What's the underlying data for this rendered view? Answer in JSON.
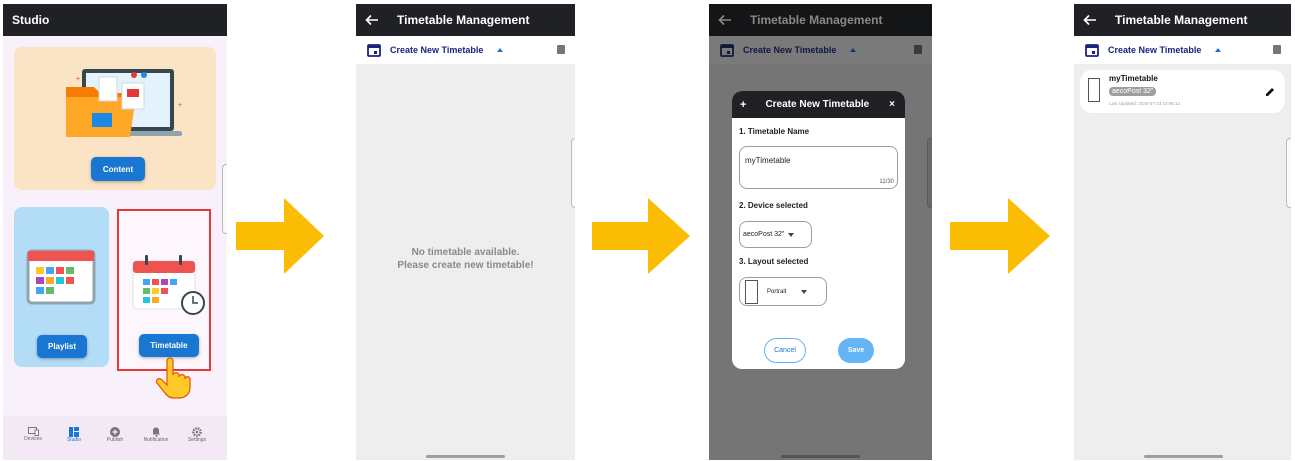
{
  "screen1": {
    "title": "Studio",
    "content_button": "Content",
    "playlist_button": "Playlist",
    "timetable_button": "Timetable",
    "nav": [
      {
        "label": "Devices",
        "icon": "devices-icon"
      },
      {
        "label": "Studio",
        "icon": "studio-icon"
      },
      {
        "label": "Publish",
        "icon": "publish-icon"
      },
      {
        "label": "Notification",
        "icon": "bell-icon"
      },
      {
        "label": "Settings",
        "icon": "gear-icon"
      }
    ],
    "active_nav": "Studio",
    "accent": "#1976d2"
  },
  "screen2": {
    "title": "Timetable Management",
    "create_label": "Create New Timetable",
    "empty_line1": "No timetable available.",
    "empty_line2": "Please create new timetable!"
  },
  "screen3": {
    "title": "Timetable Management",
    "create_label": "Create New Timetable",
    "dialog": {
      "title": "Create New Timetable",
      "section1": "1. Timetable Name",
      "name_value": "myTimetable",
      "counter": "11/30",
      "section2": "2. Device selected",
      "device_value": "aecoPost 32\"",
      "section3": "3. Layout selected",
      "layout_value": "Portrait",
      "cancel": "Cancel",
      "save": "Save"
    }
  },
  "screen4": {
    "title": "Timetable Management",
    "create_label": "Create New Timetable",
    "item": {
      "name": "myTimetable",
      "device": "aecoPost 32\"",
      "updated": "Last Updated: 2025-07-23 10:56:12"
    }
  },
  "colors": {
    "appbar": "#202124",
    "arrow": "#fbbc04",
    "highlight": "#e53935",
    "primary": "#1976d2"
  }
}
